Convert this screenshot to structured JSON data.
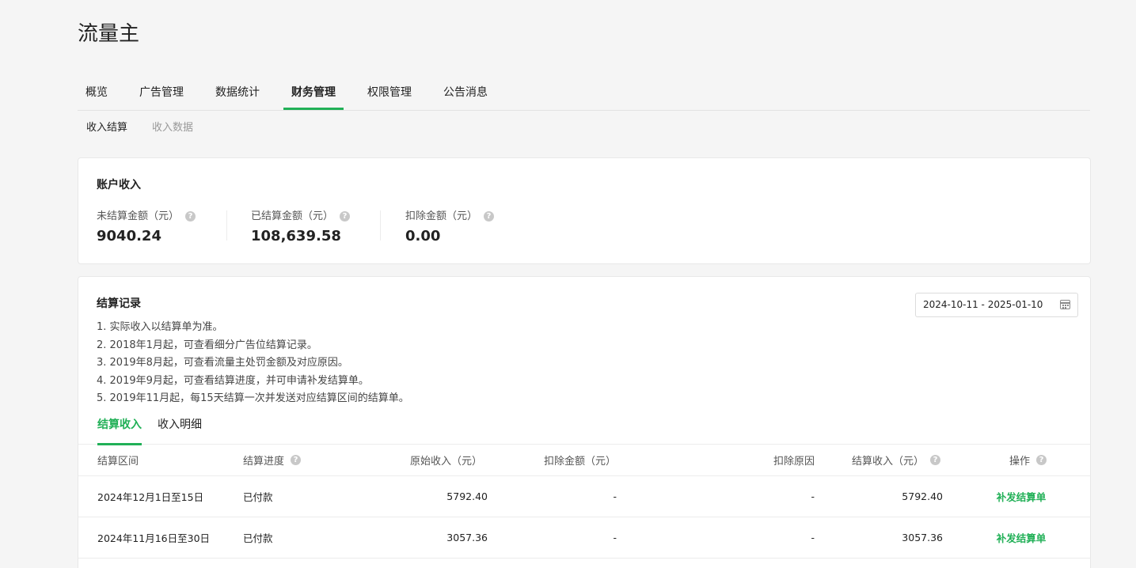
{
  "app": {
    "title": "流量主"
  },
  "main_nav": {
    "tabs": [
      {
        "label": "概览",
        "active": false
      },
      {
        "label": "广告管理",
        "active": false
      },
      {
        "label": "数据统计",
        "active": false
      },
      {
        "label": "财务管理",
        "active": true
      },
      {
        "label": "权限管理",
        "active": false
      },
      {
        "label": "公告消息",
        "active": false
      }
    ]
  },
  "sub_nav": {
    "tabs": [
      {
        "label": "收入结算",
        "active": true
      },
      {
        "label": "收入数据",
        "active": false
      }
    ]
  },
  "account_income": {
    "title": "账户收入",
    "metrics": [
      {
        "label": "未结算金额（元）",
        "value": "9040.24"
      },
      {
        "label": "已结算金额（元）",
        "value": "108,639.58"
      },
      {
        "label": "扣除金额（元）",
        "value": "0.00"
      }
    ]
  },
  "records": {
    "title": "结算记录",
    "date_range": "2024-10-11 - 2025-01-10",
    "notes": [
      "1. 实际收入以结算单为准。",
      "2. 2018年1月起，可查看细分广告位结算记录。",
      "3. 2019年8月起，可查看流量主处罚金额及对应原因。",
      "4. 2019年9月起，可查看结算进度，并可申请补发结算单。",
      "5. 2019年11月起，每15天结算一次并发送对应结算区间的结算单。"
    ],
    "tabs": [
      {
        "label": "结算收入",
        "active": true
      },
      {
        "label": "收入明细",
        "active": false
      }
    ],
    "table": {
      "columns": {
        "period": "结算区间",
        "progress": "结算进度",
        "original": "原始收入（元）",
        "deduction": "扣除金额（元）",
        "reason": "扣除原因",
        "settled": "结算收入（元）",
        "action": "操作"
      },
      "rows": [
        {
          "period": "2024年12月1日至15日",
          "progress": "已付款",
          "original": "5792.40",
          "deduction": "-",
          "reason": "-",
          "settled": "5792.40",
          "action": "补发结算单"
        },
        {
          "period": "2024年11月16日至30日",
          "progress": "已付款",
          "original": "3057.36",
          "deduction": "-",
          "reason": "-",
          "settled": "3057.36",
          "action": "补发结算单"
        }
      ]
    }
  },
  "icons": {
    "help": "question-circle-icon",
    "calendar": "calendar-icon"
  },
  "colors": {
    "accent": "#21b057"
  }
}
